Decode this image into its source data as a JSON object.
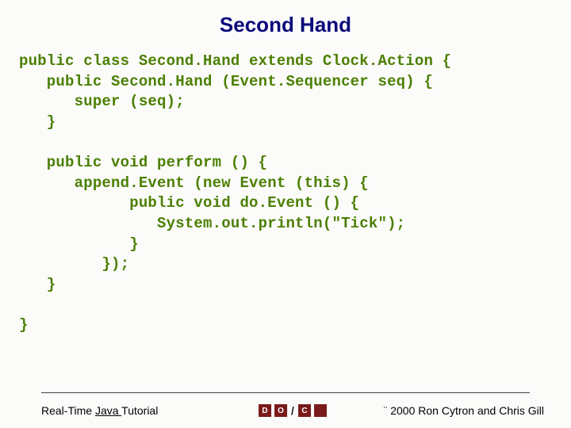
{
  "title": "Second Hand",
  "code": "public class Second.Hand extends Clock.Action {\n   public Second.Hand (Event.Sequencer seq) {\n      super (seq);\n   }\n\n   public void perform () {\n      append.Event (new Event (this) {\n            public void do.Event () {\n               System.out.println(\"Tick\");\n            }\n         });\n   }\n\n}",
  "footer": {
    "left_prefix": "Real-Time ",
    "left_underline": "Java ",
    "left_suffix": "Tutorial",
    "logo_d": "D",
    "logo_o": "O",
    "logo_c": "C",
    "right": "¨ 2000 Ron Cytron and Chris Gill"
  }
}
